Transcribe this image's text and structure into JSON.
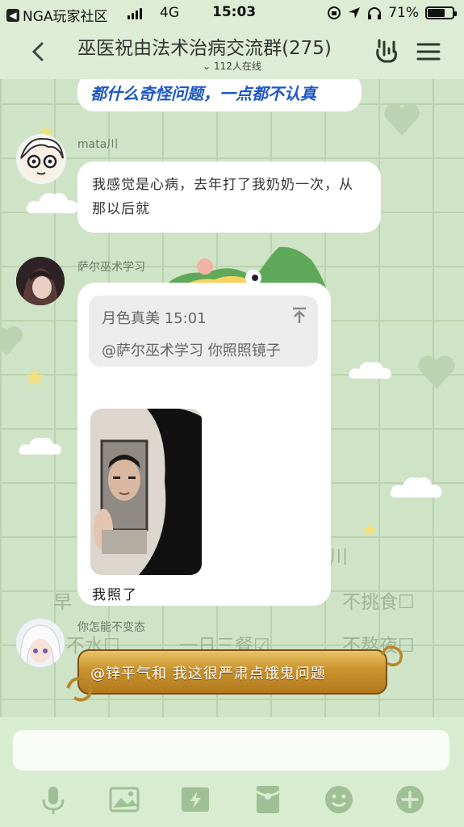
{
  "status_bar": {
    "back_app": "NGA玩家社区",
    "network": "4G",
    "time": "15:03",
    "battery": "71%",
    "battery_level": 0.71
  },
  "header": {
    "title": "巫医祝由法术治病交流群(275)",
    "online": "112人在线"
  },
  "messages": {
    "top_message": "都什么奇怪问题，一点都不认真",
    "mata": {
      "nick": "mata川",
      "text": "我感觉是心病，去年打了我奶奶一次，从那以后就"
    },
    "sal": {
      "nick": "萨尔巫术学习",
      "reply_header": "月色真美 15:01",
      "reply_text": "@萨尔巫术学习 你照照镜子",
      "caption": "我照了"
    },
    "nobian": {
      "nick": "你怎能不变态",
      "text": "@锌平气和 我这很严肃点饿鬼问题"
    }
  },
  "background_text": {
    "line1_a": "早",
    "line1_b": "不挑食☐",
    "line2_a": "不水☐",
    "line2_b": "一日三餐☑",
    "line2_c": "不熬夜☐",
    "side": "川"
  },
  "colors": {
    "bg": "#cfe3c7",
    "header": "#dcecd5",
    "mention_blue": "#1d57c5",
    "gold_bubble": "#c9922c"
  },
  "icons": [
    "back-arrow-icon",
    "rock-hand-icon",
    "menu-icon",
    "mic-icon",
    "image-icon",
    "flash-icon",
    "redpacket-icon",
    "emoji-icon",
    "plus-icon"
  ]
}
